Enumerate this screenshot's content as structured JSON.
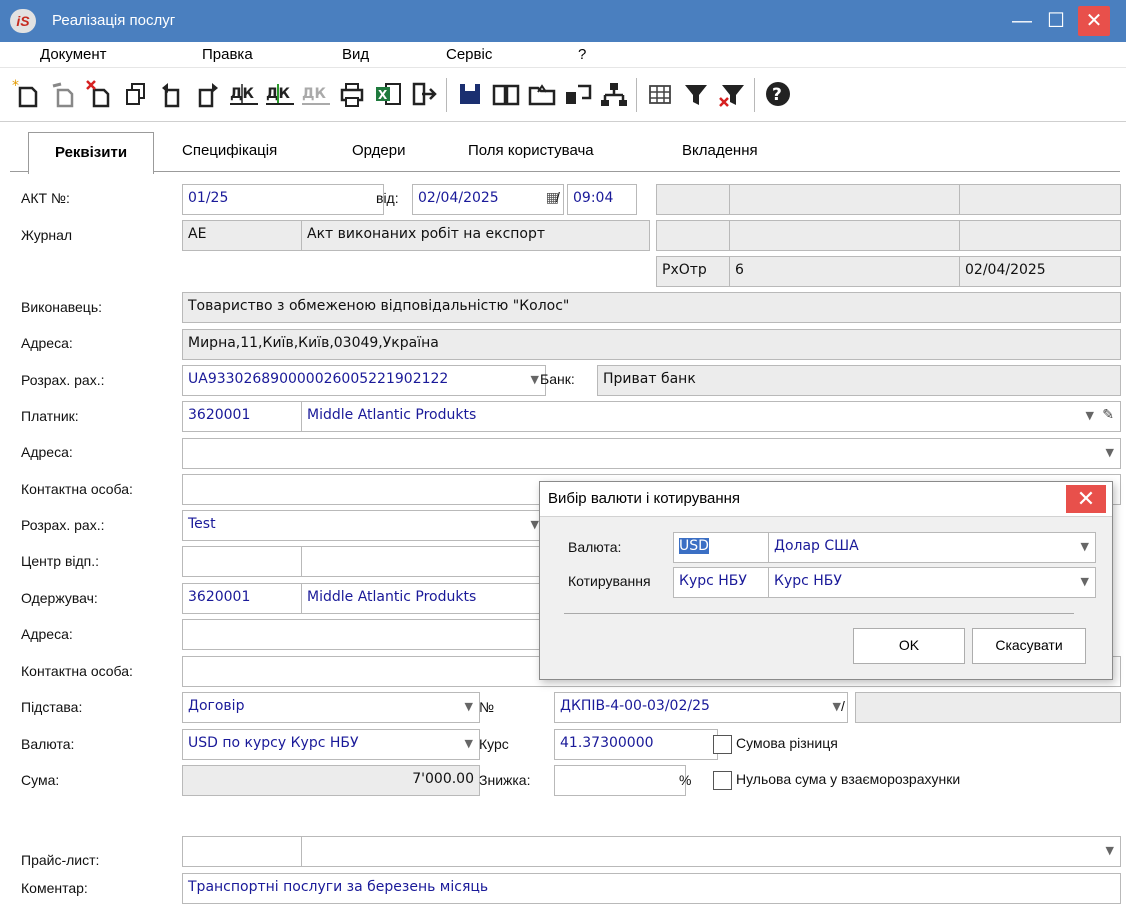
{
  "window": {
    "title": "Реалізація послуг",
    "app_icon": "iS",
    "minimize": "—",
    "maximize": "☐",
    "close": "✕"
  },
  "menu": [
    "Документ",
    "Правка",
    "Вид",
    "Сервіс",
    "?"
  ],
  "tabs": [
    "Реквізити",
    "Специфікація",
    "Ордери",
    "Поля користувача",
    "Вкладення"
  ],
  "form": {
    "akt_label": "АКТ №:",
    "akt_value": "01/25",
    "vid_label": "від:",
    "date_value": "02/04/2025",
    "slash": "/",
    "time_value": "09:04",
    "zhurnal_label": "Журнал",
    "zhurnal_code": "AE",
    "zhurnal_name": "Акт виконаних робіт на експорт",
    "rxotr_label": "РхОтр",
    "rxotr_value": "6",
    "rxotr_date": "02/04/2025",
    "vykonavets_label": "Виконавець:",
    "vykonavets_value": "Товариство з обмеженою відповідальністю \"Колос\"",
    "adresa1_label": "Адреса:",
    "adresa1_value": "Мирна,11,Київ,Київ,03049,Україна",
    "rozrax1_label": "Розрах. рах.:",
    "rozrax1_value": "UA933026890000026005221902122",
    "bank_label": "Банк:",
    "bank_value": "Приват банк",
    "platnyk_label": "Платник:",
    "platnyk_code": "3620001",
    "platnyk_name": "Middle Atlantic Produkts",
    "adresa2_label": "Адреса:",
    "kontakt1_label": "Контактна особа:",
    "rozrax2_label": "Розрах. рах.:",
    "rozrax2_value": "Test",
    "centr_label": "Центр відп.:",
    "oderzhuvach_label": "Одержувач:",
    "oderzhuvach_code": "3620001",
    "oderzhuvach_name": "Middle Atlantic Produkts",
    "adresa3_label": "Адреса:",
    "kontakt2_label": "Контактна особа:",
    "pidstava_label": "Підстава:",
    "pidstava_value": "Договір",
    "no_label": "№",
    "no_value": "ДКПІВ-4-00-03/02/25",
    "no_slash": "/",
    "valuta_label": "Валюта:",
    "valuta_value": "USD по курсу Курс НБУ",
    "kurs_label": "Курс",
    "kurs_value": "41.37300000",
    "sumova_label": "Сумова різниця",
    "suma_label": "Сума:",
    "suma_value": "7'000.00",
    "znyzhka_label": "Знижка:",
    "percent": "%",
    "nulova_label": "Нульова сума у взаєморозрахунки",
    "prais_label": "Прайс-лист:",
    "komentar_label": "Коментар:",
    "komentar_value": "Транспортні послуги за березень місяць"
  },
  "dialog": {
    "title": "Вибір валюти і котирування",
    "close": "✕",
    "valuta_label": "Валюта:",
    "valuta_code": "USD",
    "valuta_name": "Долар США",
    "kotyr_label": "Котирування",
    "kotyr_code": "Курс НБУ",
    "kotyr_name": "Курс НБУ",
    "ok": "OK",
    "cancel": "Скасувати"
  },
  "toolbar_icons": [
    "new-doc-icon",
    "new-copy-icon",
    "delete-doc-icon",
    "copy-icon",
    "up-doc-icon",
    "down-doc-icon",
    "dk-icon",
    "dk-green-icon",
    "dk-gray-icon",
    "print-icon",
    "excel-icon",
    "exit-icon",
    "save-icon",
    "book-icon",
    "folder-icon",
    "link-icon",
    "hierarchy-icon",
    "grid-icon",
    "filter-icon",
    "clear-filter-icon",
    "help-icon"
  ]
}
